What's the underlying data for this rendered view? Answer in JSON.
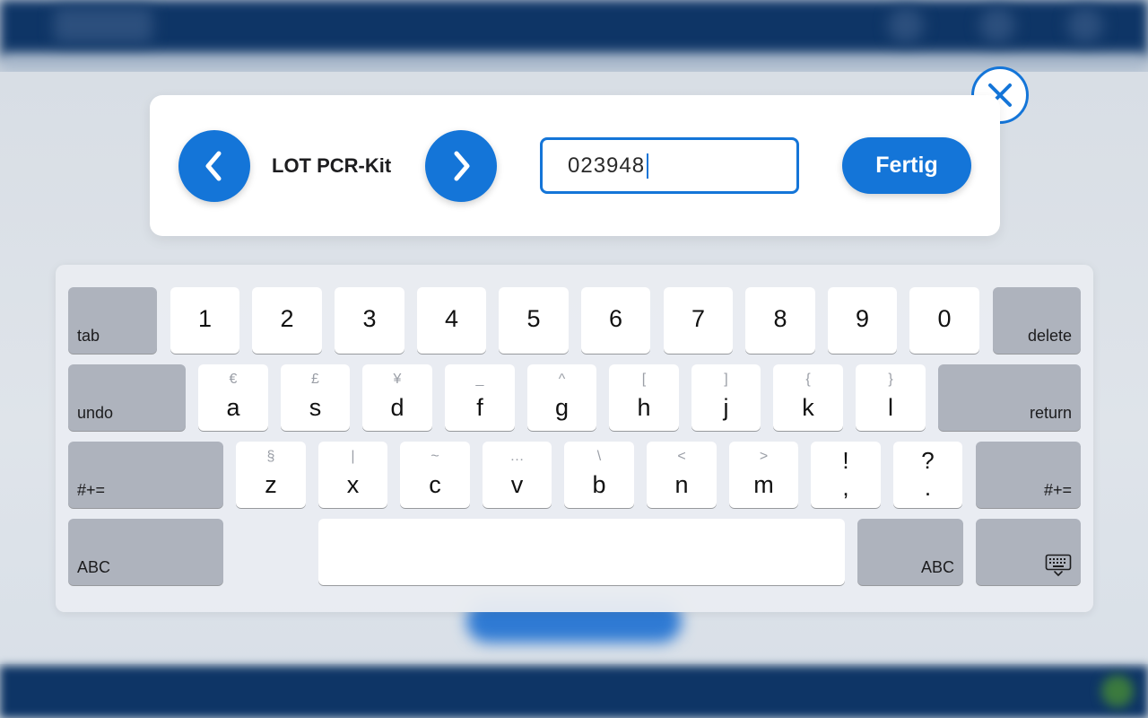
{
  "input_panel": {
    "field_label": "LOT PCR-Kit",
    "field_value": "023948",
    "done_label": "Fertig"
  },
  "keyboard": {
    "row1": {
      "tab_label": "tab",
      "keys": [
        "1",
        "2",
        "3",
        "4",
        "5",
        "6",
        "7",
        "8",
        "9",
        "0"
      ],
      "delete_label": "delete"
    },
    "row2": {
      "undo_label": "undo",
      "keys": [
        {
          "main": "a",
          "alt": "€"
        },
        {
          "main": "s",
          "alt": "£"
        },
        {
          "main": "d",
          "alt": "¥"
        },
        {
          "main": "f",
          "alt": "_"
        },
        {
          "main": "g",
          "alt": "^"
        },
        {
          "main": "h",
          "alt": "["
        },
        {
          "main": "j",
          "alt": "]"
        },
        {
          "main": "k",
          "alt": "{"
        },
        {
          "main": "l",
          "alt": "}"
        }
      ],
      "return_label": "return"
    },
    "row3": {
      "symbols_left_label": "#+=",
      "keys": [
        {
          "main": "z",
          "alt": "§"
        },
        {
          "main": "x",
          "alt": "|"
        },
        {
          "main": "c",
          "alt": "~"
        },
        {
          "main": "v",
          "alt": "…"
        },
        {
          "main": "b",
          "alt": "\\"
        },
        {
          "main": "n",
          "alt": "<"
        },
        {
          "main": "m",
          "alt": ">"
        },
        {
          "main": ",",
          "alt": "!"
        },
        {
          "main": ".",
          "alt": "?"
        }
      ],
      "symbols_right_label": "#+="
    },
    "row4": {
      "abc_left_label": "ABC",
      "abc_right_label": "ABC"
    }
  },
  "icons": {
    "prev": "chevron-left-icon",
    "next": "chevron-right-icon",
    "close": "close-icon",
    "hide_keyboard": "keyboard-hide-icon"
  },
  "colors": {
    "accent": "#1475d8",
    "key_light": "#ffffff",
    "key_dark": "#aeb3bd",
    "header_bg": "#0e3566"
  }
}
